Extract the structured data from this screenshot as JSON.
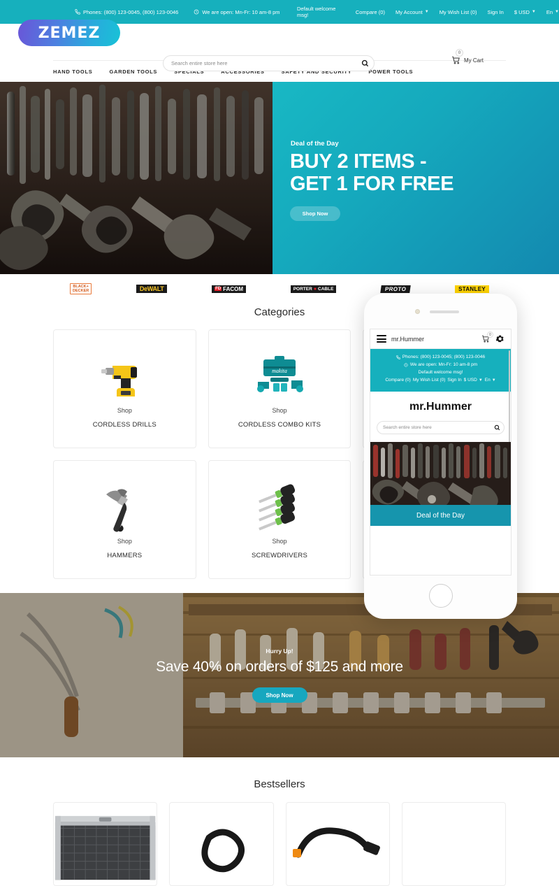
{
  "topbar": {
    "phones_label": "Phones: (800) 123-0045, (800) 123-0046",
    "hours_label": "We are open: Mn-Fr: 10 am-8 pm",
    "welcome_msg": "Default welcome msg!",
    "links": [
      {
        "label": "Compare (0)",
        "caret": false
      },
      {
        "label": "My Account",
        "caret": true
      },
      {
        "label": "My Wish List (0)",
        "caret": false
      },
      {
        "label": "Sign In",
        "caret": false
      },
      {
        "label": "$ USD",
        "caret": true
      },
      {
        "label": "En",
        "caret": true
      }
    ],
    "bg_color": "#16b0bd"
  },
  "header": {
    "logo_text": "ZEMEZ",
    "search_placeholder": "Search entire store here",
    "search_value": "",
    "cart_label": "My Cart",
    "cart_count": "0"
  },
  "nav": {
    "items": [
      "HAND TOOLS",
      "GARDEN TOOLS",
      "SPECIALS",
      "ACCESSORIES",
      "SAFETY AND SECURITY",
      "POWER TOOLS"
    ]
  },
  "hero": {
    "kicker": "Deal of the Day",
    "title_line1": "BUY 2 ITEMS -",
    "title_line2": "GET 1 FOR FREE",
    "button_label": "Shop Now",
    "accent_color": "#15a9bd"
  },
  "brands": [
    {
      "name": "BLACK+DECKER",
      "line1": "BLACK+",
      "line2": "DECKER"
    },
    {
      "name": "DeWALT",
      "line1": "DeWALT"
    },
    {
      "name": "FACOM",
      "line1": "FACOM",
      "mark": "FD"
    },
    {
      "name": "PORTER-CABLE",
      "line1": "PORTER",
      "line2": "CABLE"
    },
    {
      "name": "PROTO",
      "line1": "PROTO"
    },
    {
      "name": "STANLEY",
      "line1": "STANLEY"
    }
  ],
  "categories": {
    "title": "Categories",
    "shop_label": "Shop",
    "items": [
      {
        "name": "CORDLESS DRILLS",
        "icon": "cordless-drill"
      },
      {
        "name": "CORDLESS COMBO KITS",
        "icon": "combo-kit"
      },
      {
        "name": "",
        "icon": "hidden"
      },
      {
        "name": "HAMMERS",
        "icon": "hammer"
      },
      {
        "name": "SCREWDRIVERS",
        "icon": "screwdrivers"
      },
      {
        "name": "",
        "icon": "hidden"
      }
    ]
  },
  "promo": {
    "kicker": "Hurry Up!",
    "title": "Save 40% on orders of $125 and more",
    "button_label": "Shop Now",
    "button_color": "#17a7bf"
  },
  "bestsellers": {
    "title": "Bestsellers",
    "items": [
      {
        "image": "tool-case"
      },
      {
        "image": "black-strap"
      },
      {
        "image": "black-cable"
      },
      {
        "image": "empty"
      }
    ]
  },
  "phone_mockup": {
    "brand": "mr.Hummer",
    "cart_count": "0",
    "phones_label": "Phones: (800) 123-0045; (800) 123-0046",
    "hours_label": "We are open: Mn-Fr: 10 am-8 pm",
    "welcome_msg": "Default welcome msg!",
    "links": [
      {
        "label": "Compare (0)",
        "caret": false
      },
      {
        "label": "My Wish List (0)",
        "caret": false
      },
      {
        "label": "Sign In",
        "caret": false
      },
      {
        "label": "$ USD",
        "caret": true
      },
      {
        "label": "En",
        "caret": true
      }
    ],
    "logo_text": "mr.Hummer",
    "search_placeholder": "Search entire store here",
    "search_value": "",
    "deal_label": "Deal of the Day",
    "info_bg": "#16b0bd",
    "deal_bg": "#1695ad"
  }
}
